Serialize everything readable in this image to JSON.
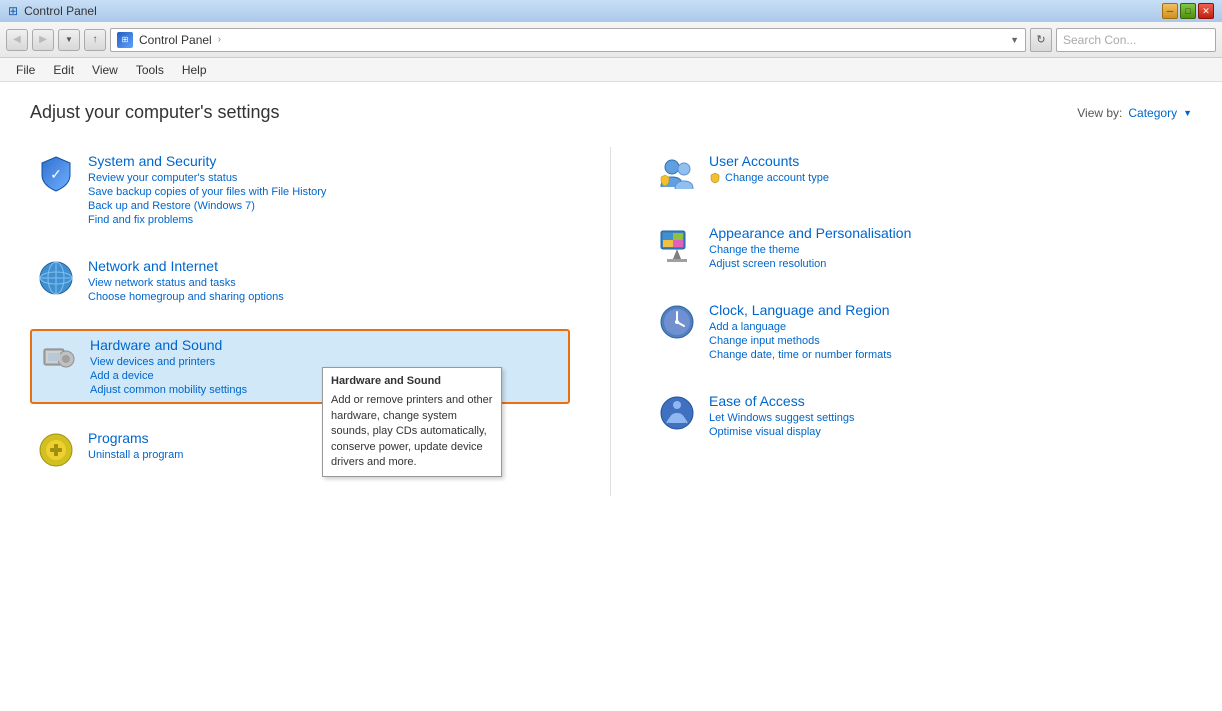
{
  "window": {
    "title": "Control Panel",
    "icon": "⊞"
  },
  "nav": {
    "back_label": "◀",
    "forward_label": "▶",
    "up_label": "↑",
    "address_icon": "⊞",
    "address_path": "Control Panel",
    "address_separator": "›",
    "refresh_label": "↻",
    "search_placeholder": "Search Con..."
  },
  "menu": {
    "items": [
      "File",
      "Edit",
      "View",
      "Tools",
      "Help"
    ]
  },
  "page": {
    "title": "Adjust your computer's settings",
    "viewby_label": "View by:",
    "viewby_value": "Category"
  },
  "categories": {
    "left": [
      {
        "id": "system-security",
        "title": "System and Security",
        "links": [
          "Review your computer's status",
          "Save backup copies of your files with File History",
          "Back up and Restore (Windows 7)",
          "Find and fix problems"
        ],
        "highlighted": false
      },
      {
        "id": "network-internet",
        "title": "Network and Internet",
        "links": [
          "View network status and tasks",
          "Choose homegroup and sharing options"
        ],
        "highlighted": false
      },
      {
        "id": "hardware-sound",
        "title": "Hardware and Sound",
        "links": [
          "View devices and printers",
          "Add a device",
          "Adjust common mobility settings"
        ],
        "highlighted": true
      },
      {
        "id": "programs",
        "title": "Programs",
        "links": [
          "Uninstall a program"
        ],
        "highlighted": false
      }
    ],
    "right": [
      {
        "id": "user-accounts",
        "title": "User Accounts",
        "links": [
          "Change account type"
        ]
      },
      {
        "id": "appearance",
        "title": "Appearance and Personalisation",
        "links": [
          "Change the theme",
          "Adjust screen resolution"
        ]
      },
      {
        "id": "clock",
        "title": "Clock, Language and Region",
        "links": [
          "Add a language",
          "Change input methods",
          "Change date, time or number formats"
        ]
      },
      {
        "id": "ease-access",
        "title": "Ease of Access",
        "links": [
          "Let Windows suggest settings",
          "Optimise visual display"
        ]
      }
    ]
  },
  "tooltip": {
    "title": "Hardware and Sound",
    "description": "Add or remove printers and other hardware, change system sounds, play CDs automatically, conserve power, update device drivers and more."
  }
}
